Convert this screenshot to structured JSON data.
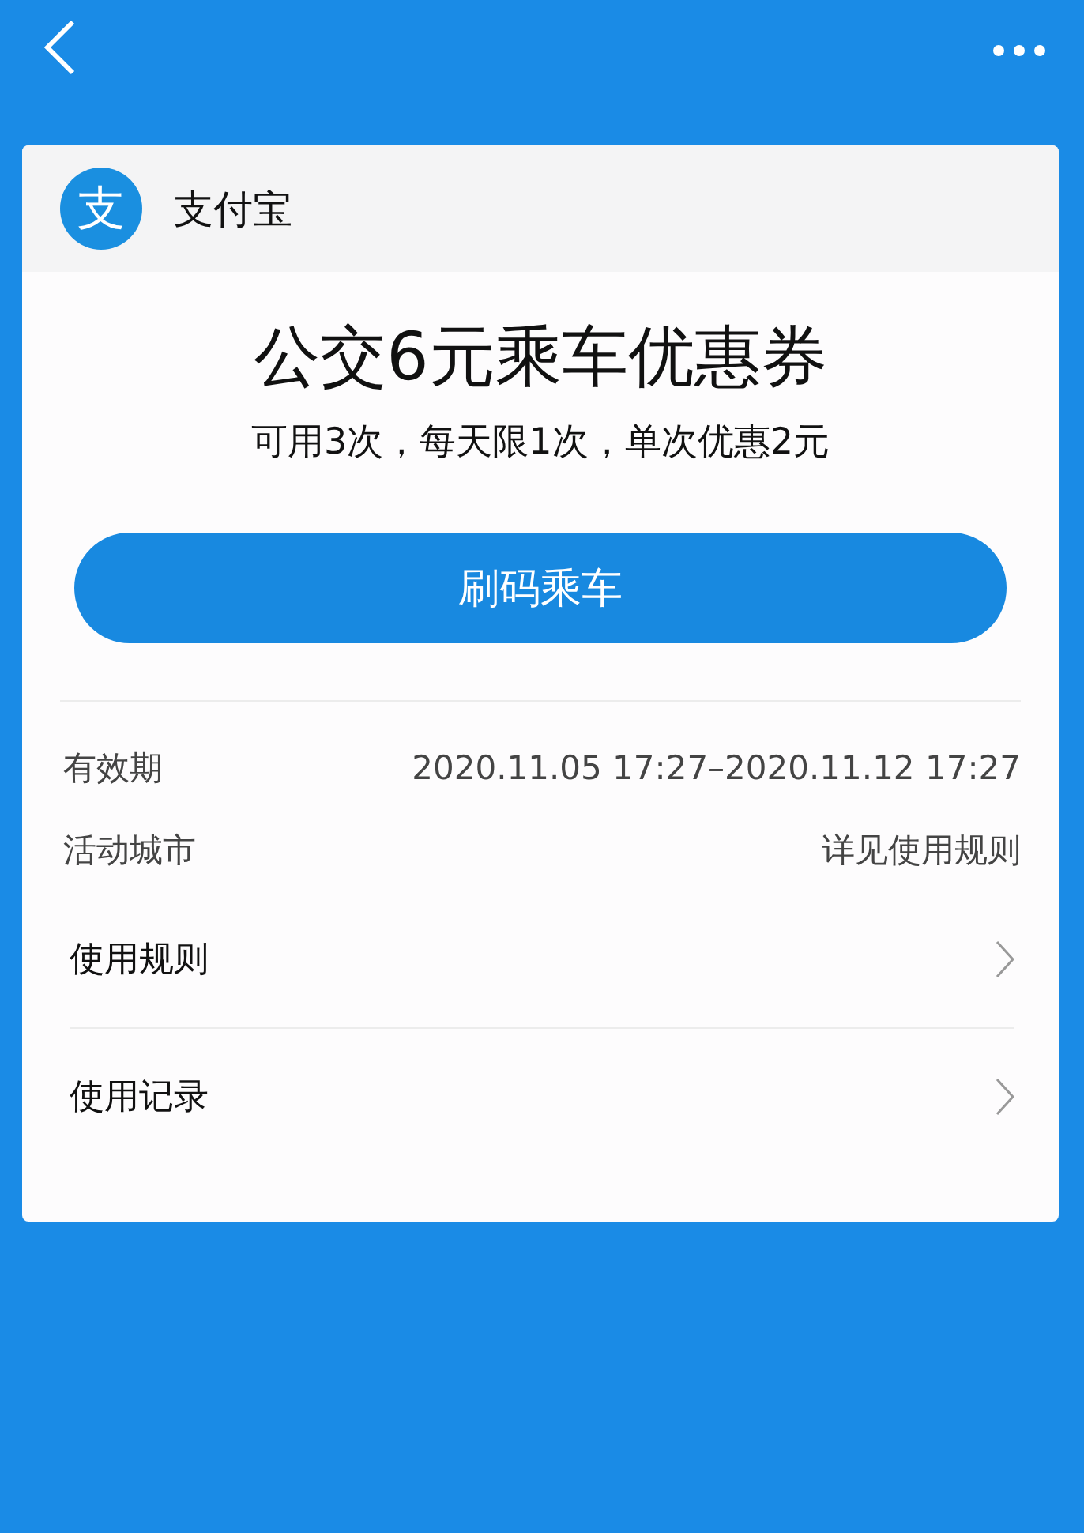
{
  "issuer": {
    "logo_glyph": "支",
    "name": "支付宝"
  },
  "coupon": {
    "title": "公交6元乘车优惠券",
    "subtitle": "可用3次，每天限1次，单次优惠2元",
    "button": "刷码乘车"
  },
  "details": [
    {
      "label": "有效期",
      "value": "2020.11.05 17:27–2020.11.12 17:27"
    },
    {
      "label": "活动城市",
      "value": "详见使用规则"
    }
  ],
  "links": [
    {
      "label": "使用规则"
    },
    {
      "label": "使用记录"
    }
  ]
}
